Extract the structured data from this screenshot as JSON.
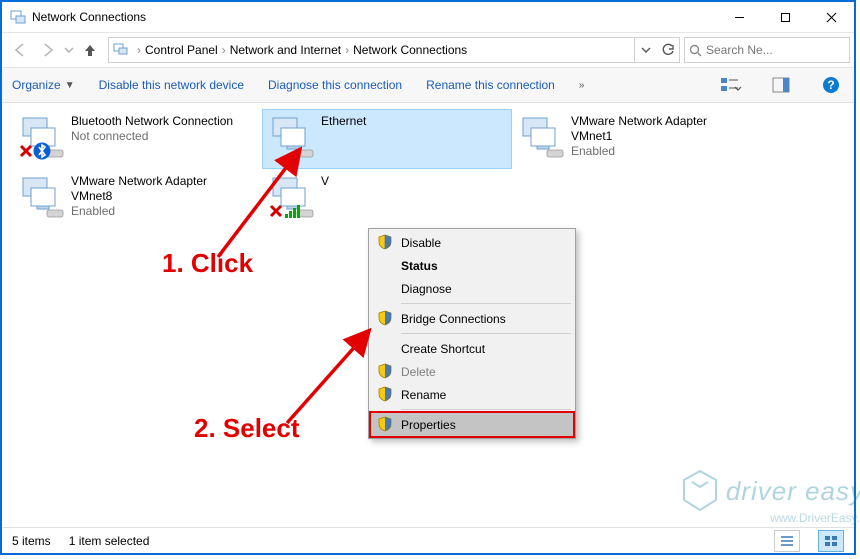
{
  "window": {
    "title": "Network Connections"
  },
  "breadcrumb": [
    "Control Panel",
    "Network and Internet",
    "Network Connections"
  ],
  "search": {
    "placeholder": "Search Ne..."
  },
  "commands": {
    "organize": "Organize",
    "disable": "Disable this network device",
    "diagnose": "Diagnose this connection",
    "rename": "Rename this connection"
  },
  "adapters": [
    {
      "name": "Bluetooth Network Connection",
      "status": "Not connected",
      "selected": false
    },
    {
      "name": "Ethernet",
      "status": "",
      "selected": true
    },
    {
      "name": "VMware Network Adapter VMnet1",
      "status": "Enabled",
      "selected": false
    },
    {
      "name": "VMware Network Adapter VMnet8",
      "status": "Enabled",
      "selected": false
    },
    {
      "name": "V",
      "status": "",
      "selected": false
    }
  ],
  "context_menu": [
    {
      "label": "Disable",
      "shield": true,
      "disabled": false,
      "bold": false
    },
    {
      "label": "Status",
      "shield": false,
      "disabled": false,
      "bold": true
    },
    {
      "label": "Diagnose",
      "shield": false,
      "disabled": false,
      "bold": false
    },
    {
      "label": "Bridge Connections",
      "shield": true,
      "disabled": false,
      "bold": false
    },
    {
      "label": "Create Shortcut",
      "shield": false,
      "disabled": false,
      "bold": false
    },
    {
      "label": "Delete",
      "shield": true,
      "disabled": true,
      "bold": false
    },
    {
      "label": "Rename",
      "shield": true,
      "disabled": false,
      "bold": false
    },
    {
      "label": "Properties",
      "shield": true,
      "disabled": false,
      "bold": false,
      "highlighted": true
    }
  ],
  "annotations": [
    "1. Click",
    "2. Select"
  ],
  "watermark": {
    "brand": "driver easy",
    "url": "www.DriverEasy."
  },
  "status": {
    "items": "5 items",
    "selected": "1 item selected"
  },
  "colors": {
    "accent": "#066bd6",
    "selection": "#cce8ff",
    "annotation": "#e30000"
  }
}
